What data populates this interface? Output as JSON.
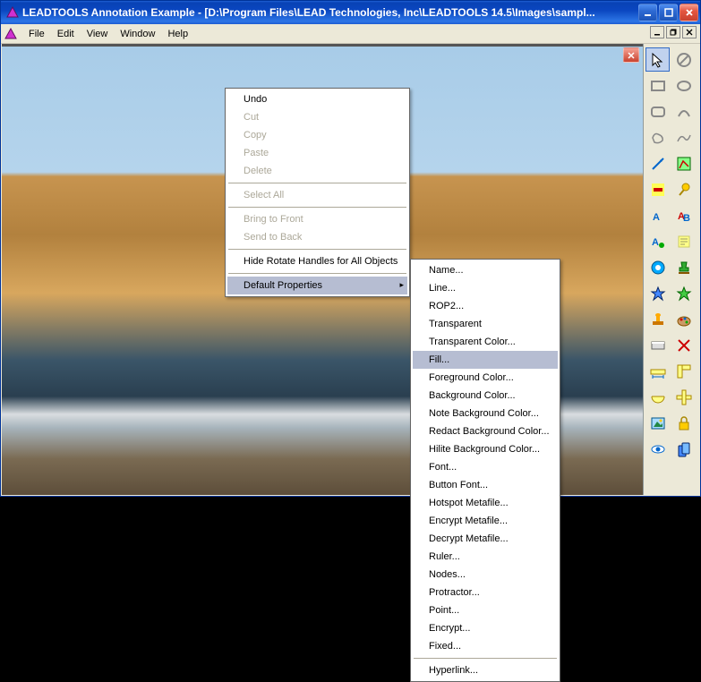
{
  "title": "LEADTOOLS Annotation Example - [D:\\Program Files\\LEAD Technologies, Inc\\LEADTOOLS 14.5\\Images\\sampl...",
  "menubar": [
    "File",
    "Edit",
    "View",
    "Window",
    "Help"
  ],
  "context_menu": {
    "items": [
      {
        "label": "Undo",
        "enabled": true
      },
      {
        "label": "Cut",
        "enabled": false
      },
      {
        "label": "Copy",
        "enabled": false
      },
      {
        "label": "Paste",
        "enabled": false
      },
      {
        "label": "Delete",
        "enabled": false
      },
      {
        "sep": true
      },
      {
        "label": "Select All",
        "enabled": false
      },
      {
        "sep": true
      },
      {
        "label": "Bring to Front",
        "enabled": false
      },
      {
        "label": "Send to Back",
        "enabled": false
      },
      {
        "sep": true
      },
      {
        "label": "Hide Rotate Handles for All Objects",
        "enabled": true
      },
      {
        "sep": true
      },
      {
        "label": "Default Properties",
        "enabled": true,
        "sub": true,
        "hl": true
      }
    ]
  },
  "submenu": {
    "items": [
      {
        "label": "Name..."
      },
      {
        "label": "Line..."
      },
      {
        "label": "ROP2..."
      },
      {
        "label": "Transparent"
      },
      {
        "label": "Transparent Color..."
      },
      {
        "label": "Fill...",
        "hl": true
      },
      {
        "label": "Foreground Color..."
      },
      {
        "label": "Background Color..."
      },
      {
        "label": "Note Background Color..."
      },
      {
        "label": "Redact Background Color..."
      },
      {
        "label": "Hilite Background Color..."
      },
      {
        "label": "Font..."
      },
      {
        "label": "Button Font..."
      },
      {
        "label": "Hotspot Metafile..."
      },
      {
        "label": "Encrypt Metafile..."
      },
      {
        "label": "Decrypt Metafile..."
      },
      {
        "label": "Ruler..."
      },
      {
        "label": "Nodes..."
      },
      {
        "label": "Protractor..."
      },
      {
        "label": "Point..."
      },
      {
        "label": "Encrypt..."
      },
      {
        "label": "Fixed..."
      },
      {
        "sep": true
      },
      {
        "label": "Hyperlink..."
      }
    ]
  },
  "tools": [
    "select-tool",
    "nodraw-tool",
    "rect-tool",
    "oval-tool",
    "roundrect-tool",
    "arc-tool",
    "freehand-closed",
    "freehand-open",
    "line-tool",
    "hilite-tool",
    "redact-tool",
    "pushpin-tool",
    "text-tool",
    "textedit-tool",
    "textpointer-tool",
    "note-tool",
    "hotspot-tool",
    "stamp-tool",
    "point-blue",
    "point-green",
    "rubber-stamp",
    "paint-tool",
    "button-tool",
    "crossproduct-tool",
    "ruler-tool",
    "protractor-tool",
    "polyruler-tool",
    "crossruler-tool",
    "image-tool",
    "encrypt-tool",
    "eye-tool",
    "decrypt-tool"
  ]
}
